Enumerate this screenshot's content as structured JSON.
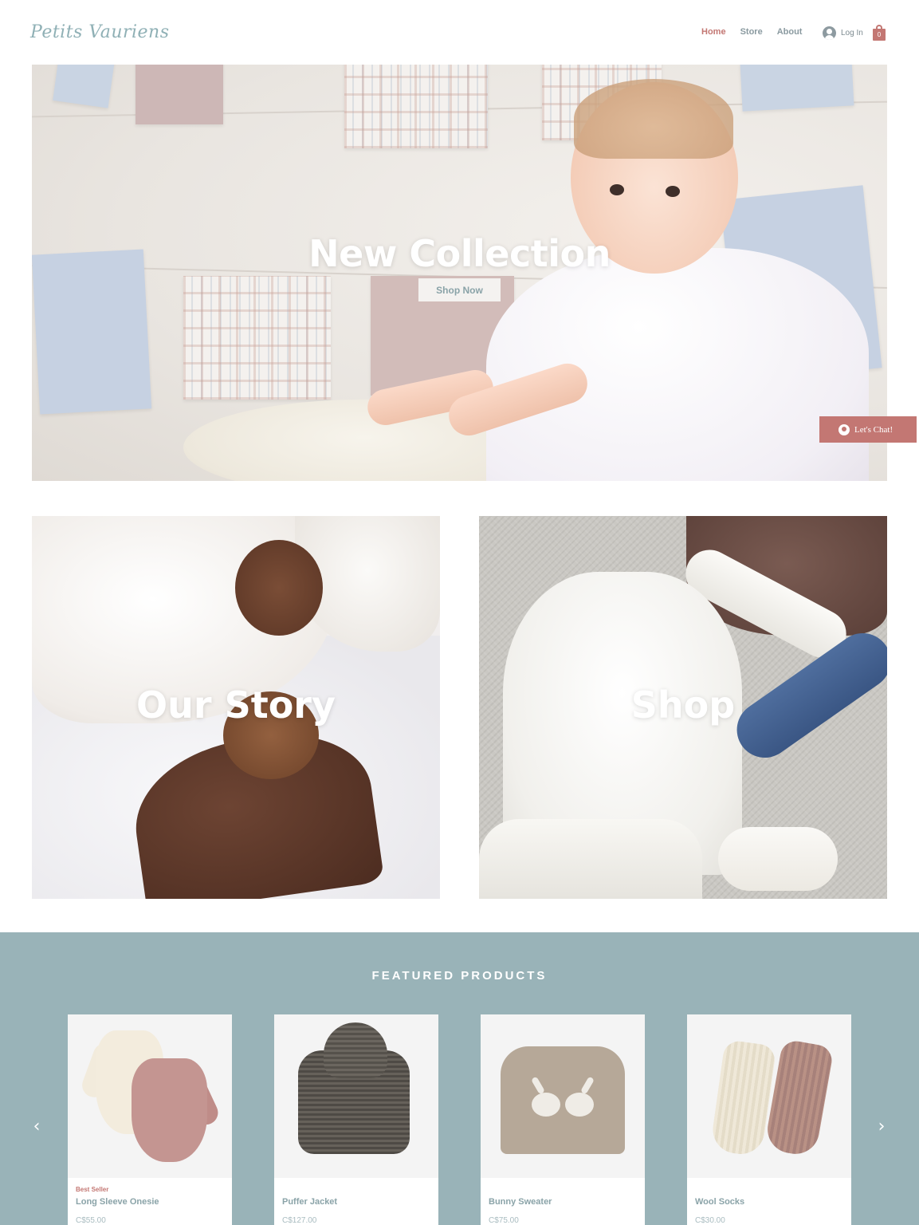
{
  "header": {
    "logo": "Petits Vauriens",
    "nav": [
      {
        "label": "Home",
        "active": true
      },
      {
        "label": "Store",
        "active": false
      },
      {
        "label": "About",
        "active": false
      }
    ],
    "login_label": "Log In",
    "cart_count": "0"
  },
  "hero": {
    "title": "New Collection",
    "button_label": "Shop Now"
  },
  "chat": {
    "label": "Let's Chat!"
  },
  "tiles": {
    "story_title": "Our Story",
    "shop_title": "Shop"
  },
  "featured": {
    "title": "FEATURED PRODUCTS",
    "products": [
      {
        "badge": "Best Seller",
        "name": "Long Sleeve Onesie",
        "price": "C$55.00"
      },
      {
        "badge": "",
        "name": "Puffer Jacket",
        "price": "C$127.00"
      },
      {
        "badge": "",
        "name": "Bunny Sweater",
        "price": "C$75.00"
      },
      {
        "badge": "",
        "name": "Wool Socks",
        "price": "C$30.00"
      }
    ]
  },
  "colors": {
    "accent": "#c37773",
    "teal": "#99b3b8",
    "nav_text": "#8a9aa0"
  },
  "icons": [
    "user-icon",
    "cart-icon",
    "chat-icon",
    "chevron-left-icon",
    "chevron-right-icon"
  ]
}
